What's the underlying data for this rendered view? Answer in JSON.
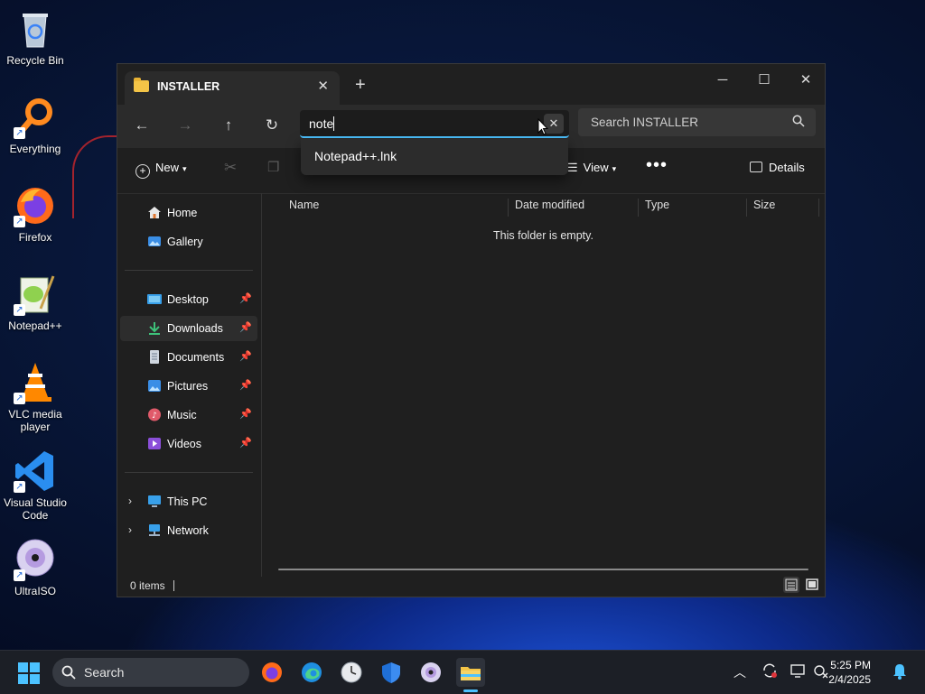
{
  "desktop": {
    "icons": [
      {
        "label": "Recycle Bin",
        "icon": "recycle-bin-icon"
      },
      {
        "label": "Everything",
        "icon": "everything-search-icon"
      },
      {
        "label": "Firefox",
        "icon": "firefox-icon"
      },
      {
        "label": "Notepad++",
        "icon": "notepad-plus-plus-icon"
      },
      {
        "label": "VLC media player",
        "icon": "vlc-cone-icon"
      },
      {
        "label": "Visual Studio Code",
        "icon": "vscode-icon"
      },
      {
        "label": "UltraISO",
        "icon": "ultraiso-disc-icon"
      }
    ]
  },
  "window": {
    "tab_title": "INSTALLER",
    "address": {
      "value": "note"
    },
    "search": {
      "placeholder": "Search INSTALLER"
    },
    "suggestion": "Notepad++.lnk",
    "toolbar": {
      "new_label": "New",
      "view_label": "View",
      "details_label": "Details"
    },
    "nav": {
      "quick": [
        {
          "label": "Home",
          "icon": "home-icon"
        },
        {
          "label": "Gallery",
          "icon": "gallery-icon"
        }
      ],
      "pinned": [
        {
          "label": "Desktop",
          "icon": "desktop-folder-icon"
        },
        {
          "label": "Downloads",
          "icon": "downloads-folder-icon"
        },
        {
          "label": "Documents",
          "icon": "documents-folder-icon"
        },
        {
          "label": "Pictures",
          "icon": "pictures-folder-icon"
        },
        {
          "label": "Music",
          "icon": "music-folder-icon"
        },
        {
          "label": "Videos",
          "icon": "videos-folder-icon"
        }
      ],
      "locations": [
        {
          "label": "This PC",
          "icon": "this-pc-icon"
        },
        {
          "label": "Network",
          "icon": "network-icon"
        }
      ]
    },
    "columns": [
      "Name",
      "Date modified",
      "Type",
      "Size"
    ],
    "empty_message": "This folder is empty.",
    "status": {
      "items": "0 items"
    }
  },
  "taskbar": {
    "search_label": "Search",
    "apps": [
      "firefox-icon",
      "edge-icon",
      "clock-app-icon",
      "defender-shield-icon",
      "ultraiso-disc-icon",
      "file-explorer-icon"
    ],
    "time": "5:25 PM",
    "date": "2/4/2025"
  },
  "colors": {
    "accent": "#4cc2ff",
    "folder": "#f3c447"
  }
}
